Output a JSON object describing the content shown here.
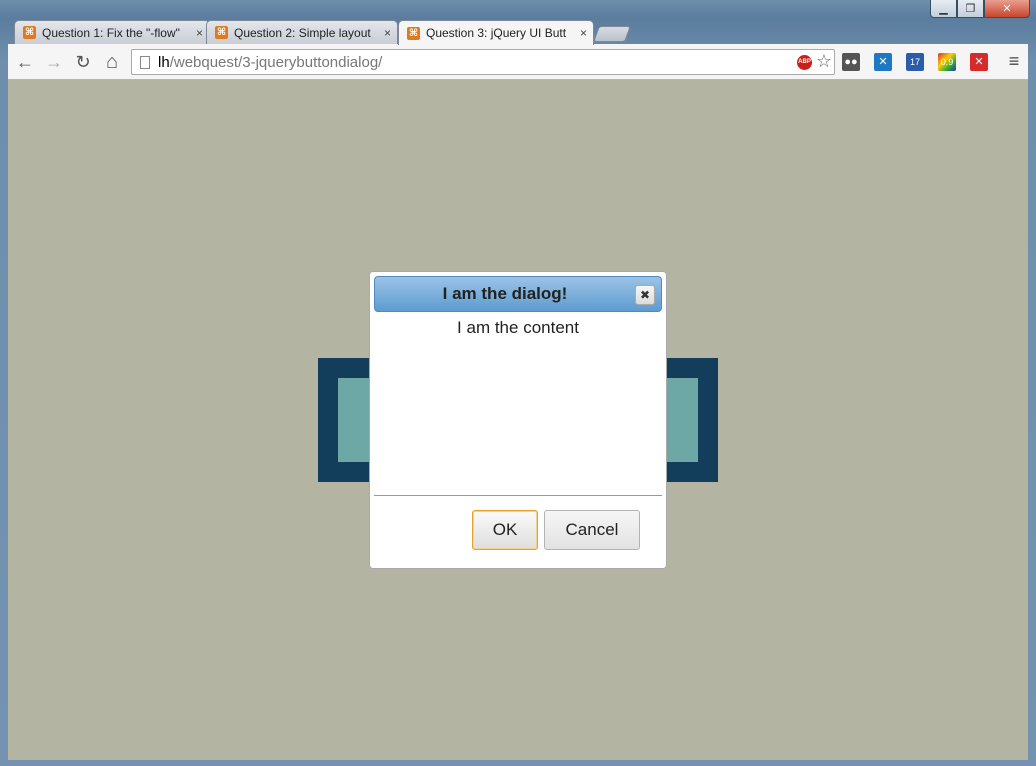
{
  "window": {
    "minimize_glyph": "▁",
    "maximize_glyph": "❐",
    "close_glyph": "✕"
  },
  "tabs": [
    {
      "label": "Question 1: Fix the \"-flow\"",
      "close": "×",
      "favicon": "⌘",
      "active": false
    },
    {
      "label": "Question 2: Simple layout",
      "close": "×",
      "favicon": "⌘",
      "active": false
    },
    {
      "label": "Question 3: jQuery UI Butt",
      "close": "×",
      "favicon": "⌘",
      "active": true
    }
  ],
  "toolbar": {
    "back_glyph": "←",
    "forward_glyph": "→",
    "reload_glyph": "↻",
    "home_glyph": "⌂",
    "url_host": "lh",
    "url_path": "/webquest/3-jquerybuttondialog/",
    "abp_label": "ABP",
    "star_glyph": "☆",
    "menu_glyph": "≡",
    "extensions": [
      {
        "name": "glasses-extension-icon",
        "glyph": "●●",
        "color": "#555555"
      },
      {
        "name": "x-extension-icon",
        "glyph": "✕",
        "color": "#1f78c4"
      },
      {
        "name": "sitemap-extension-icon",
        "glyph": "17",
        "color": "#2a5caa"
      },
      {
        "name": "color-extension-icon",
        "glyph": "0.9",
        "color": "#3a9a3a"
      },
      {
        "name": "red-x-extension-icon",
        "glyph": "✕",
        "color": "#d62b2b"
      }
    ]
  },
  "dialog": {
    "title": "I am the dialog!",
    "close_glyph": "✖",
    "content": "I am the content",
    "ok_label": "OK",
    "cancel_label": "Cancel"
  },
  "colors": {
    "page_background": "#b3b5a2",
    "box_outer": "#123d5b",
    "box_inner": "#6ea8a6",
    "dialog_header": "#5d9ccf",
    "ok_focus_border": "#e3a22b"
  }
}
